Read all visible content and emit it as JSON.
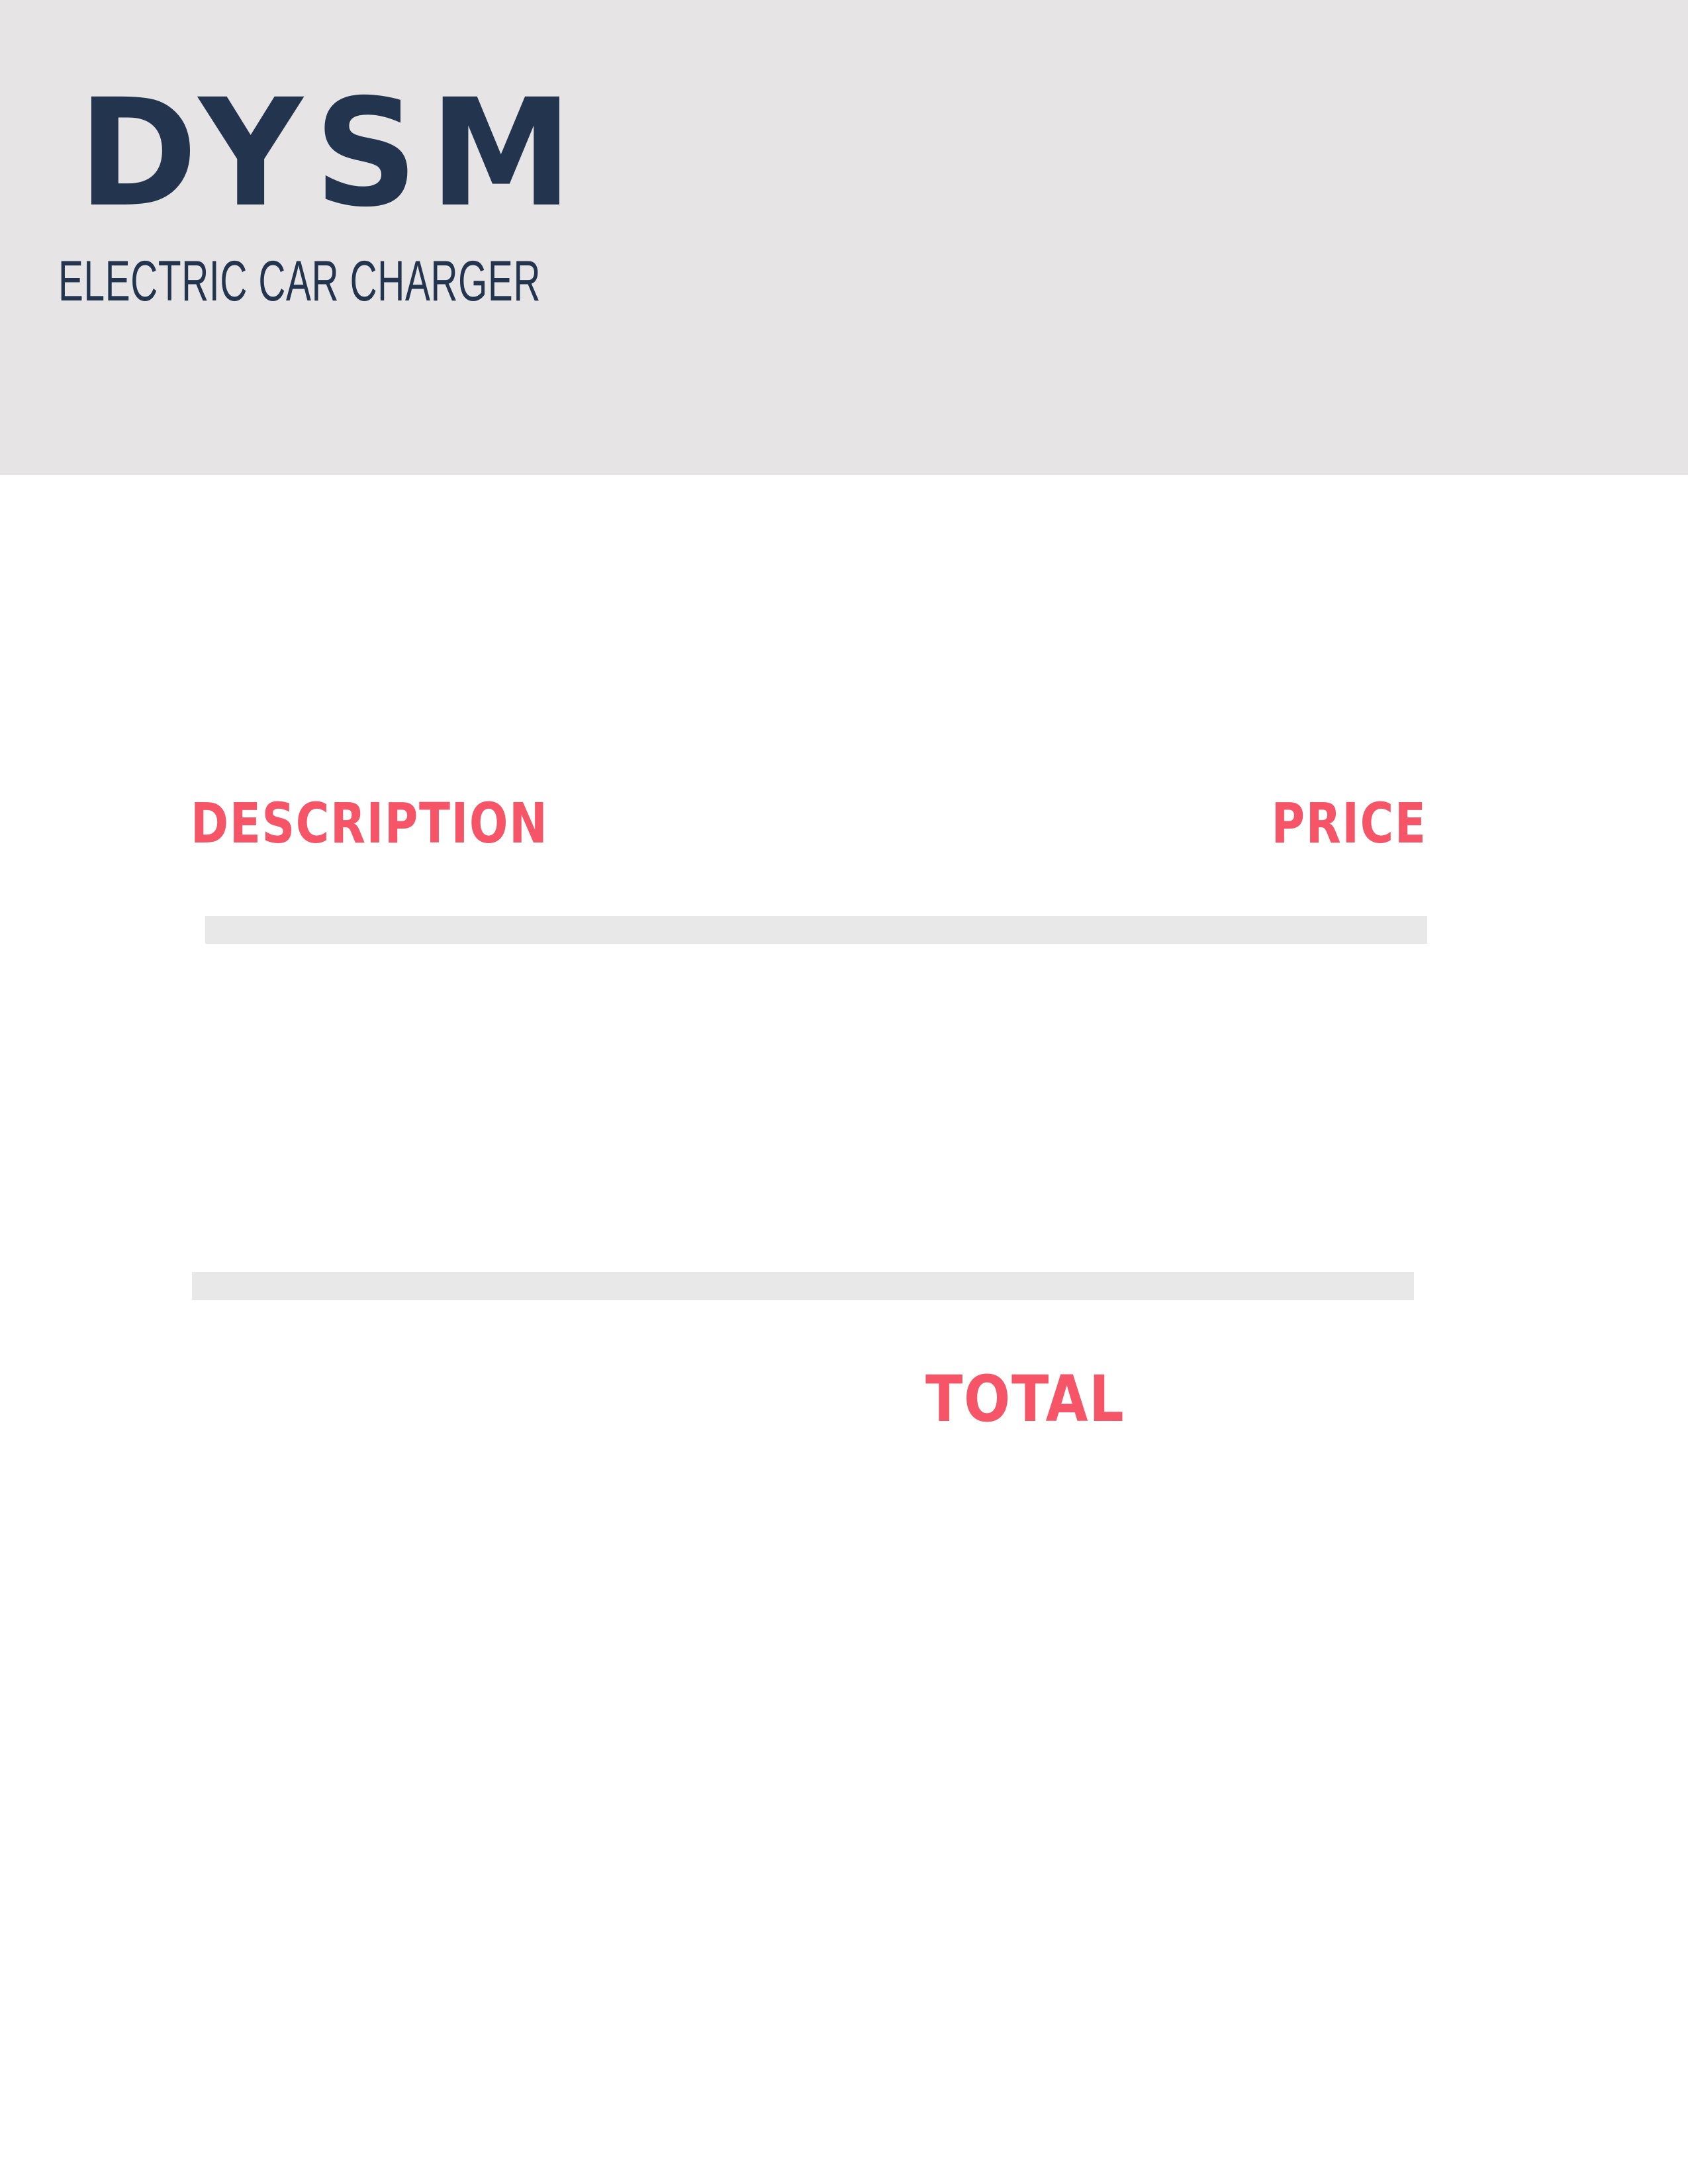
{
  "header": {
    "brand": "DYSM",
    "tagline": "ELECTRIC CAR CHARGER"
  },
  "table": {
    "columns": [
      "DESCRIPTION",
      "PRICE"
    ],
    "total_label": "TOTAL"
  },
  "colors": {
    "header_background": "#e6e4e5",
    "brand_text": "#23344e",
    "accent": "#f65467",
    "divider": "#e8e8e8"
  }
}
